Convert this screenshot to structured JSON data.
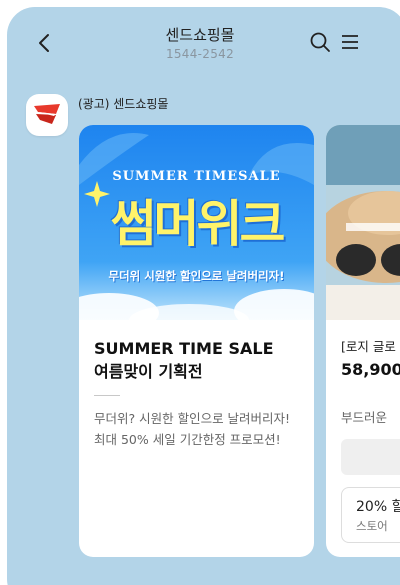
{
  "header": {
    "title": "센드쇼핑몰",
    "phone": "1544-2542",
    "back_icon": "chevron-left-icon",
    "search_icon": "search-icon",
    "menu_icon": "hamburger-menu-icon"
  },
  "message": {
    "sender_label": "(광고) 센드쇼핑몰",
    "avatar_icon": "send-logo-icon"
  },
  "cards": [
    {
      "banner": {
        "top_text": "SUMMER TIMESALE",
        "big_text": "썸머위크",
        "sub_text": "무더위 시원한 할인으로 날려버리자!"
      },
      "title_line1": "SUMMER TIME SALE",
      "title_line2": "여름맞이 기획전",
      "desc_line1": "무더위? 시원한 할인으로 날려버리자!",
      "desc_line2": "최대 50% 세일 기간한정 프로모션!"
    },
    {
      "name": "[로지 글로",
      "price": "58,900",
      "desc": "부드러운",
      "coupon_line1": "20% 할",
      "coupon_line2": "스토어"
    }
  ],
  "colors": {
    "background": "#b3d4e8",
    "banner_blue": "#2a8cf0",
    "banner_yellow": "#fff36a",
    "logo_red": "#e8392c"
  }
}
